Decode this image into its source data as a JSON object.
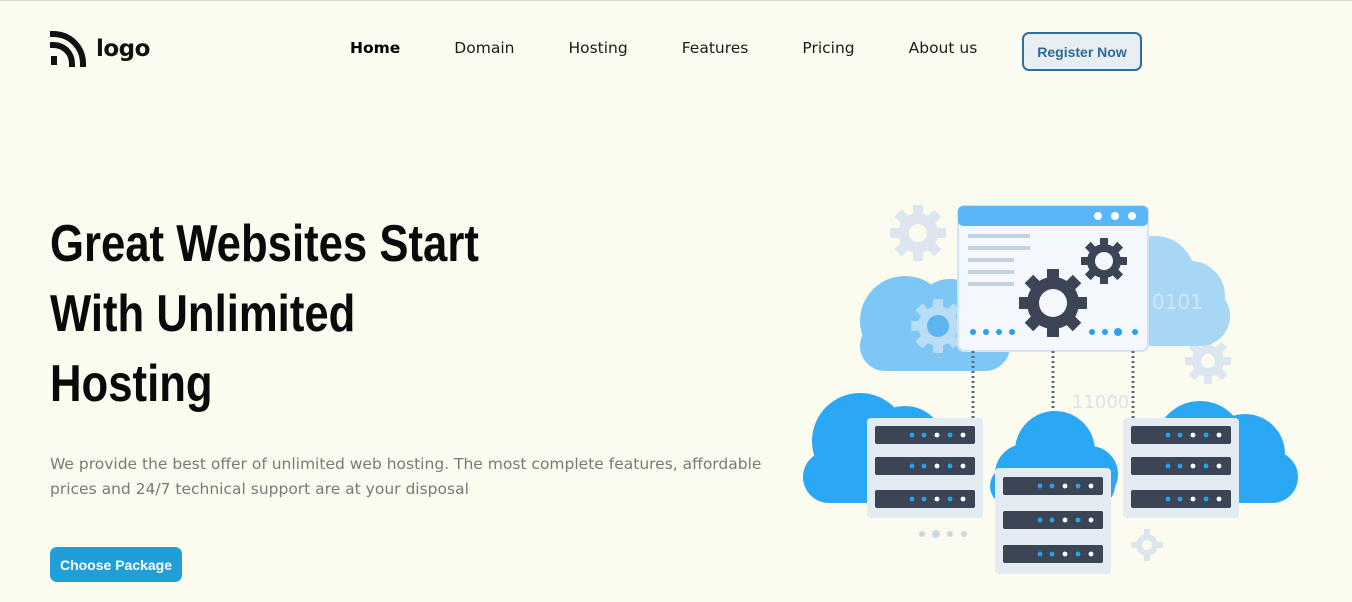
{
  "brand": {
    "logo_text": "logo",
    "logo_icon": "rss-icon"
  },
  "nav": {
    "items": [
      {
        "label": "Home",
        "active": true
      },
      {
        "label": "Domain",
        "active": false
      },
      {
        "label": "Hosting",
        "active": false
      },
      {
        "label": "Features",
        "active": false
      },
      {
        "label": "Pricing",
        "active": false
      },
      {
        "label": "About us",
        "active": false
      }
    ],
    "register_label": "Register Now"
  },
  "hero": {
    "headline_lines": [
      "Great Websites Start",
      "With Unlimited",
      "Hosting"
    ],
    "description": "We provide the best offer of unlimited web hosting. The most complete features, affordable prices and 24/7 technical support are at your disposal",
    "cta_label": "Choose Package"
  },
  "illustration": {
    "binary_text_1": "0101",
    "binary_text_2": "11000"
  },
  "colors": {
    "background": "#fbfbef",
    "accent": "#1e9fd8",
    "register_border": "#2c6e9c",
    "cloud": "#2aa8f5",
    "server": "#3b4556"
  }
}
